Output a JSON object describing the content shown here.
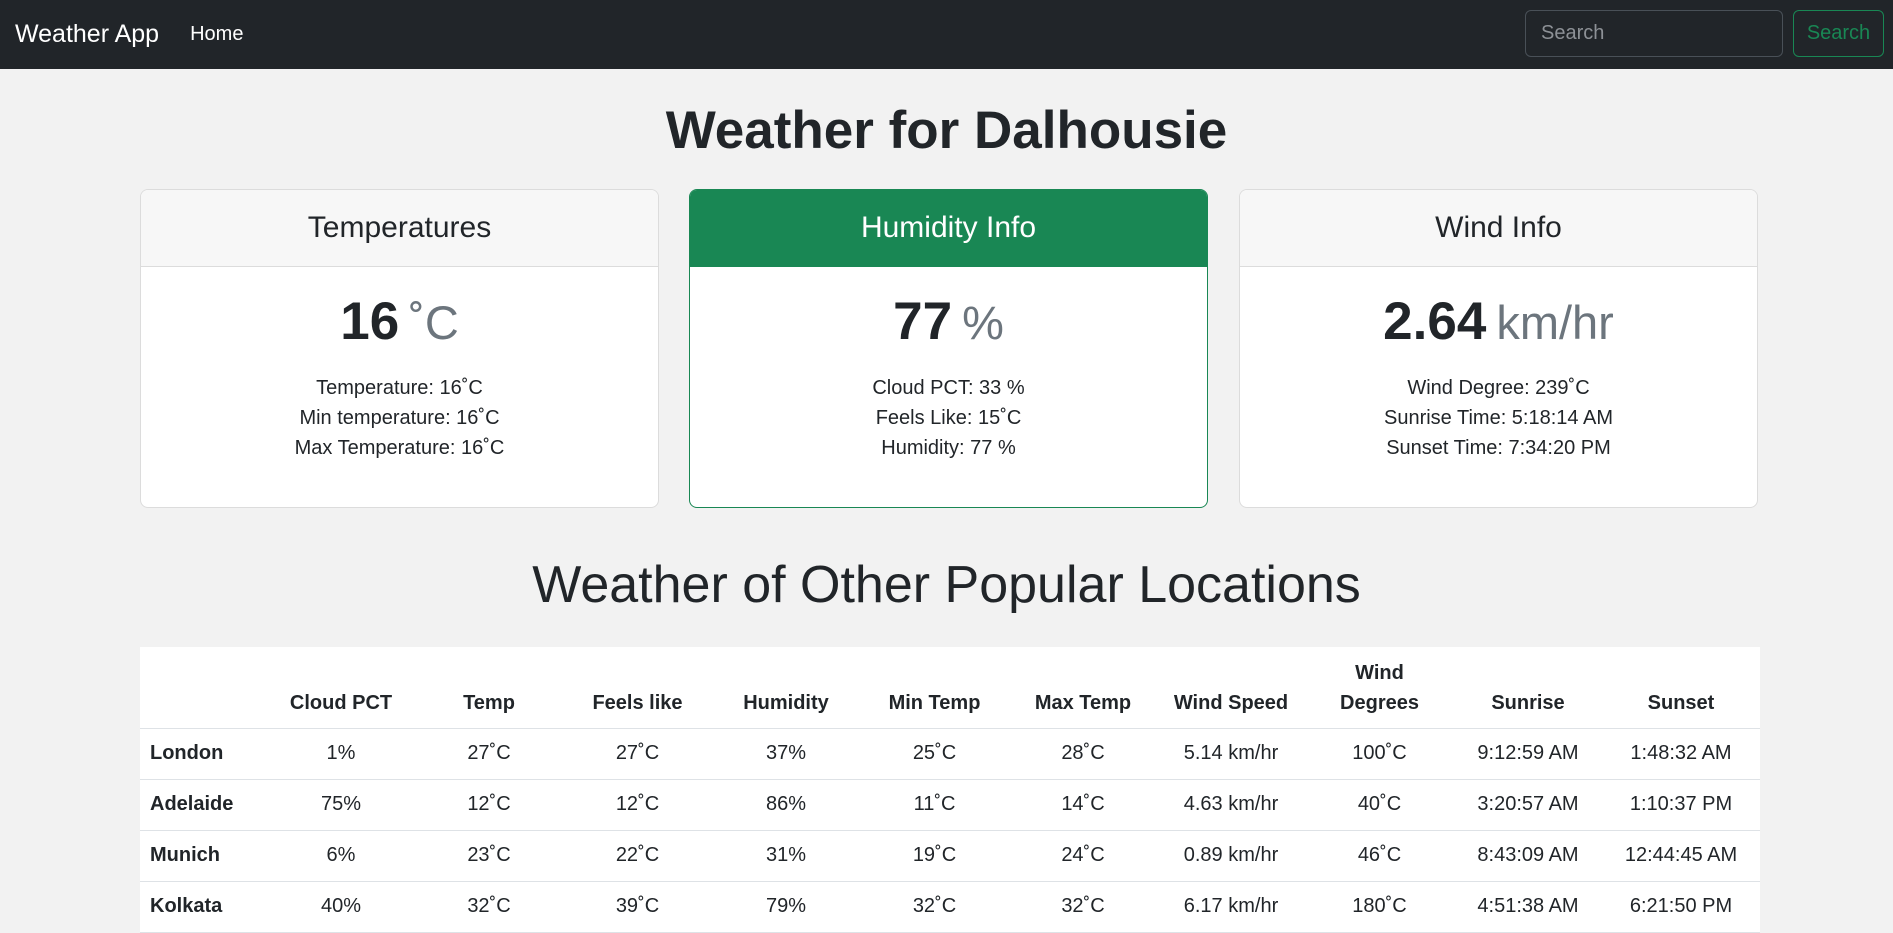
{
  "navbar": {
    "brand": "Weather App",
    "home": "Home",
    "search_placeholder": "Search",
    "search_button": "Search"
  },
  "title": "Weather for Dalhousie",
  "cards": {
    "temperatures": {
      "header": "Temperatures",
      "value": "16",
      "unit": "˚C",
      "lines": [
        "Temperature: 16˚C",
        "Min temperature: 16˚C",
        "Max Temperature: 16˚C"
      ]
    },
    "humidity": {
      "header": "Humidity Info",
      "value": "77",
      "unit": "%",
      "lines": [
        "Cloud PCT: 33 %",
        "Feels Like: 15˚C",
        "Humidity: 77 %"
      ]
    },
    "wind": {
      "header": "Wind Info",
      "value": "2.64",
      "unit": "km/hr",
      "lines": [
        "Wind Degree: 239˚C",
        "Sunrise Time: 5:18:14 AM",
        "Sunset Time: 7:34:20 PM"
      ]
    }
  },
  "colors": {
    "accent": "#198754",
    "navbar": "#212529",
    "background": "#f2f2f2"
  },
  "popular": {
    "heading": "Weather of Other Popular Locations",
    "columns": [
      "",
      "Cloud PCT",
      "Temp",
      "Feels like",
      "Humidity",
      "Min Temp",
      "Max Temp",
      "Wind Speed",
      "Wind Degrees",
      "Sunrise",
      "Sunset"
    ],
    "rows": [
      [
        "London",
        "1%",
        "27˚C",
        "27˚C",
        "37%",
        "25˚C",
        "28˚C",
        "5.14 km/hr",
        "100˚C",
        "9:12:59 AM",
        "1:48:32 AM"
      ],
      [
        "Adelaide",
        "75%",
        "12˚C",
        "12˚C",
        "86%",
        "11˚C",
        "14˚C",
        "4.63 km/hr",
        "40˚C",
        "3:20:57 AM",
        "1:10:37 PM"
      ],
      [
        "Munich",
        "6%",
        "23˚C",
        "22˚C",
        "31%",
        "19˚C",
        "24˚C",
        "0.89 km/hr",
        "46˚C",
        "8:43:09 AM",
        "12:44:45 AM"
      ],
      [
        "Kolkata",
        "40%",
        "32˚C",
        "39˚C",
        "79%",
        "32˚C",
        "32˚C",
        "6.17 km/hr",
        "180˚C",
        "4:51:38 AM",
        "6:21:50 PM"
      ]
    ]
  }
}
